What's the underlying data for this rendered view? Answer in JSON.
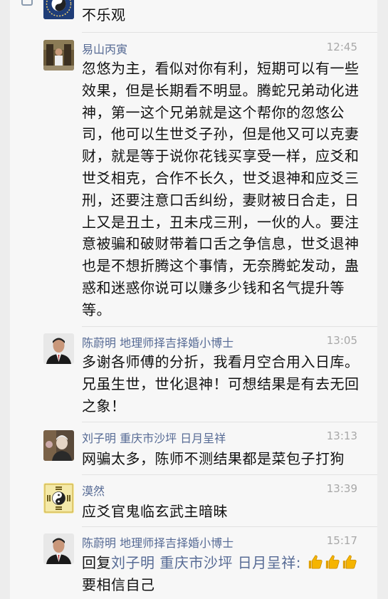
{
  "messages": [
    {
      "id": "m0",
      "name": "",
      "time": "",
      "text": "不乐观"
    },
    {
      "id": "m1",
      "name": "易山丙寅",
      "time": "12:45",
      "text": "忽悠为主，看似对你有利，短期可以有一些效果，但是长期看不明显。腾蛇兄弟动化进神，第一这个兄弟就是这个帮你的忽悠公司，他可以生世爻子孙，但是他又可以克妻财，就是等于说你花钱买享受一样，应爻和世爻相克，合作不长久，世爻退神和应爻三刑，还要注意口舌纠纷，妻财被日合走，日上又是丑土，丑未戌三刑，一伙的人。要注意被骗和破财带着口舌之争信息，世爻退神也是不想折腾这个事情，无奈腾蛇发动，蛊惑和迷惑你说可以赚多少钱和名气提升等等。"
    },
    {
      "id": "m2",
      "name": "陈蔚明  地理师择吉择婚小博士",
      "time": "13:05",
      "text": "多谢各师傅的分折，我看月空合用入日库。兄虽生世，世化退神！可想结果是有去无回之象！"
    },
    {
      "id": "m3",
      "name": "刘子明  重庆市沙坪  日月呈祥",
      "time": "13:13",
      "text": "网骗太多，陈师不测结果都是菜包子打狗"
    },
    {
      "id": "m4",
      "name": "漠然",
      "time": "13:39",
      "text": "应爻官鬼临玄武主暗昧"
    },
    {
      "id": "m5",
      "name": "陈蔚明  地理师择吉择婚小博士",
      "time": "15:17",
      "reply_prefix": "回复",
      "reply_name": "刘子明  重庆市沙坪  日月呈祥",
      "reply_colon": ":",
      "text": "要相信自己",
      "thumb_icon": "thumbs-up-icon"
    }
  ],
  "colors": {
    "name": "#576b95",
    "time": "#a8a8a8",
    "text": "#111111",
    "background": "#f7f7f7",
    "thumb": "#f5b400"
  }
}
